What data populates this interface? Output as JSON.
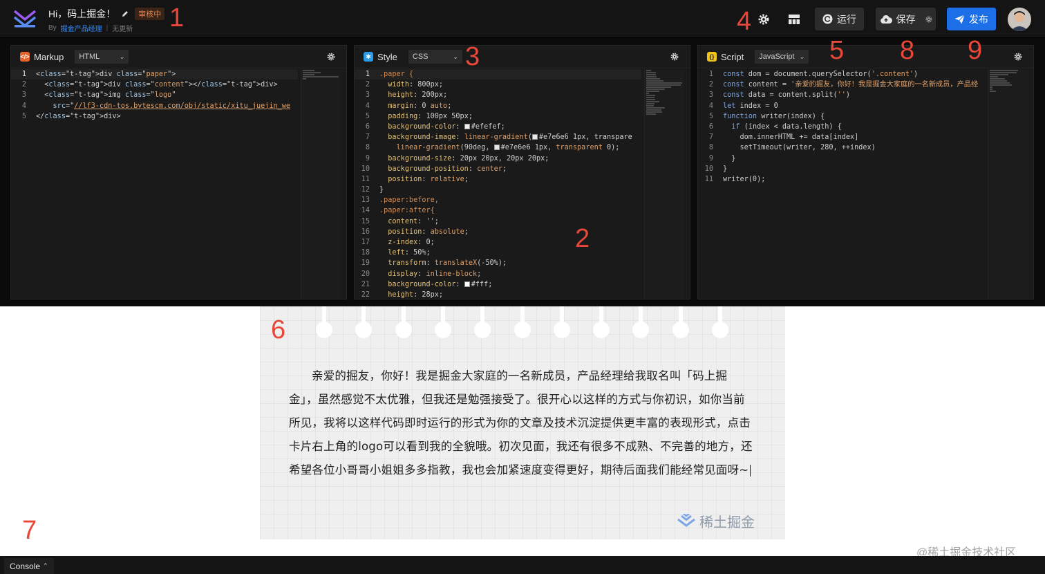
{
  "header": {
    "title": "Hi，码上掘金！",
    "status_badge": "审核中",
    "by_label": "By",
    "author": "掘金产品经理",
    "separator": "|",
    "update_status": "无更新",
    "run_label": "运行",
    "save_label": "保存",
    "publish_label": "发布"
  },
  "panels": {
    "markup": {
      "title": "Markup",
      "lang": "HTML",
      "icon": "html-icon",
      "icon_color": "#e8622b"
    },
    "style": {
      "title": "Style",
      "lang": "CSS",
      "icon": "css-icon",
      "icon_color": "#2d9ce8"
    },
    "script": {
      "title": "Script",
      "lang": "JavaScript",
      "icon": "js-icon",
      "icon_color": "#f0c419"
    }
  },
  "code": {
    "markup": [
      "<div class=\"paper\">",
      "  <div class=\"content\"></div>",
      "  <img class=\"logo\"",
      "    src=\"//lf3-cdn-tos.bytescm.com/obj/static/xitu_juejin_we",
      "</div>"
    ],
    "style": [
      ".paper {",
      "  width: 800px;",
      "  height: 200px;",
      "  margin: 0 auto;",
      "  padding: 100px 50px;",
      "  background-color: #efefef;",
      "  background-image: linear-gradient(#e7e6e6 1px, transpare",
      "    linear-gradient(90deg, #e7e6e6 1px, transparent 0);",
      "  background-size: 20px 20px, 20px 20px;",
      "  background-position: center;",
      "  position: relative;",
      "}",
      ".paper:before,",
      ".paper:after{",
      "  content: '';",
      "  position: absolute;",
      "  z-index: 0;",
      "  left: 50%;",
      "  transform: translateX(-50%);",
      "  display: inline-block;",
      "  background-color: #fff;",
      "  height: 28px;"
    ],
    "script": [
      "const dom = document.querySelector('.content')",
      "const content = '亲爱的掘友，你好！我是掘金大家庭的一名新成员，产品经",
      "const data = content.split('')",
      "let index = 0",
      "function writer(index) {",
      "  if (index < data.length) {",
      "    dom.innerHTML += data[index]",
      "    setTimeout(writer, 280, ++index)",
      "  }",
      "}",
      "writer(0);"
    ]
  },
  "preview": {
    "text": "亲爱的掘友，你好！我是掘金大家庭的一名新成员，产品经理给我取名叫「码上掘金」，虽然感觉不太优雅，但我还是勉强接受了。很开心以这样的方式与你初识，如你当前所见，我将以这样代码即时运行的形式为你的文章及技术沉淀提供更丰富的表现形式，点击卡片右上角的logo可以看到我的全貌哦。初次见面，我还有很多不成熟、不完善的地方，还希望各位小哥哥小姐姐多多指教，我也会加紧速度变得更好，期待后面我们能经常见面呀~",
    "brand": "稀土掘金",
    "hole_count": 11
  },
  "watermark": "@稀土掘金技术社区",
  "console": {
    "label": "Console"
  },
  "annotations": [
    "1",
    "2",
    "3",
    "4",
    "5",
    "6",
    "7",
    "8",
    "9"
  ],
  "colors": {
    "accent": "#1d6fe8",
    "annotation": "#e8473a",
    "badge": "#e8804a"
  }
}
